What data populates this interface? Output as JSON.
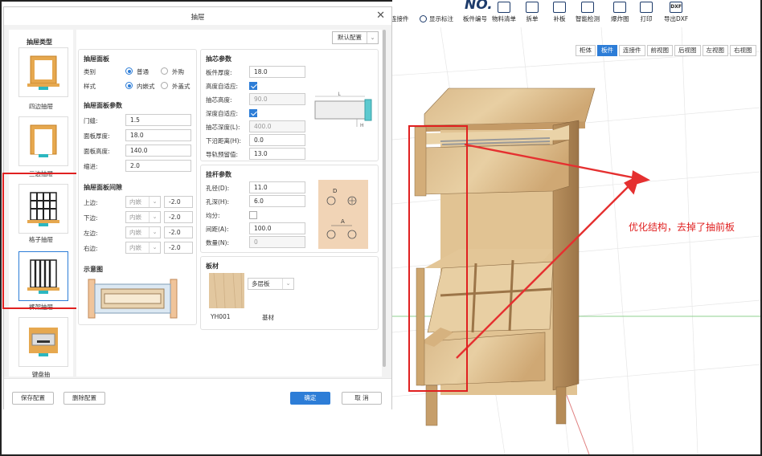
{
  "toolbar": {
    "partial_left": "连接件",
    "show_label": "显示标注",
    "logo_text": "NO.",
    "items": [
      "板件编号",
      "物料清单",
      "拆单",
      "补板",
      "智能检测",
      "爆炸图",
      "打印",
      "导出DXF"
    ],
    "dxf_badge": "DXF"
  },
  "view_tabs": [
    "柜体",
    "板件",
    "连接件",
    "前视图",
    "后视图",
    "左视图",
    "右视图"
  ],
  "view_tab_active": "板件",
  "annotation": "优化结构，去掉了抽前板",
  "dialog": {
    "title": "抽屉",
    "preset": "默认配置",
    "sidebar": {
      "title": "抽屉类型",
      "items": [
        "四边抽屉",
        "三边抽屉",
        "格子抽屉",
        "裤架抽屉",
        "键盘抽"
      ],
      "selected": "裤架抽屉"
    },
    "face": {
      "title": "抽屉面板",
      "type_label": "类别",
      "type_options": [
        "普通",
        "外购"
      ],
      "type_selected": "普通",
      "style_label": "样式",
      "style_options": [
        "内嵌式",
        "外盖式"
      ],
      "style_selected": "内嵌式"
    },
    "face_params": {
      "title": "抽屉面板参数",
      "rows": [
        {
          "label": "门缝:",
          "value": "1.5"
        },
        {
          "label": "面板厚度:",
          "value": "18.0"
        },
        {
          "label": "面板高度:",
          "value": "140.0"
        },
        {
          "label": "缩进:",
          "value": "2.0"
        }
      ]
    },
    "gaps": {
      "title": "抽屉面板间隙",
      "rows": [
        {
          "label": "上边:",
          "mode": "内嵌",
          "value": "-2.0"
        },
        {
          "label": "下边:",
          "mode": "内嵌",
          "value": "-2.0"
        },
        {
          "label": "左边:",
          "mode": "内嵌",
          "value": "-2.0"
        },
        {
          "label": "右边:",
          "mode": "内嵌",
          "value": "-2.0"
        }
      ]
    },
    "schematic_title": "示意图",
    "core": {
      "title": "抽芯参数",
      "rows": [
        {
          "label": "板件厚度:",
          "value": "18.0",
          "type": "input"
        },
        {
          "label": "高度自适应:",
          "value": "",
          "type": "check"
        },
        {
          "label": "抽芯高度:",
          "value": "90.0",
          "type": "disabled"
        },
        {
          "label": "深度自适应:",
          "value": "",
          "type": "check"
        },
        {
          "label": "抽芯深度(L):",
          "value": "400.0",
          "type": "disabled"
        },
        {
          "label": "下沿距离(H):",
          "value": "0.0",
          "type": "input"
        },
        {
          "label": "导轨预留值:",
          "value": "13.0",
          "type": "input"
        }
      ],
      "diagram_labels": {
        "l": "L",
        "h": "H"
      }
    },
    "rod": {
      "title": "挂杆参数",
      "rows": [
        {
          "label": "孔径(D):",
          "value": "11.0",
          "type": "input"
        },
        {
          "label": "孔深(H):",
          "value": "6.0",
          "type": "input"
        },
        {
          "label": "均分:",
          "value": "",
          "type": "checkoff"
        },
        {
          "label": "间距(A):",
          "value": "100.0",
          "type": "input"
        },
        {
          "label": "数量(N):",
          "value": "0",
          "type": "disabled"
        }
      ],
      "diagram_labels": {
        "d": "D",
        "a": "A"
      }
    },
    "material": {
      "title": "板材",
      "code": "YH001",
      "select_value": "多层板",
      "base_label": "基材"
    },
    "footer": {
      "save": "保存配置",
      "delete": "删除配置",
      "ok": "确定",
      "cancel": "取 消"
    }
  }
}
